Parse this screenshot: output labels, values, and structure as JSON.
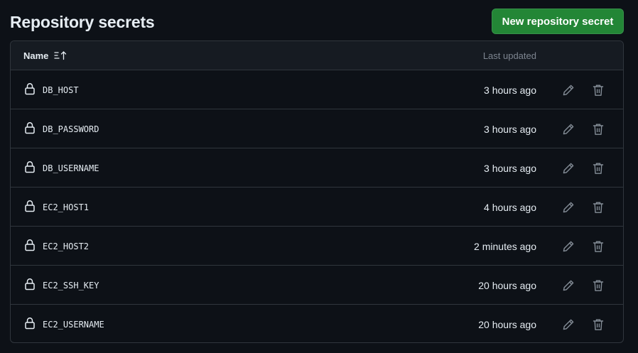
{
  "page": {
    "title": "Repository secrets",
    "new_secret_label": "New repository secret"
  },
  "table": {
    "name_header": "Name",
    "updated_header": "Last updated",
    "sort_icon": "sort-ascending-icon",
    "rows": [
      {
        "name": "DB_HOST",
        "updated": "3 hours ago"
      },
      {
        "name": "DB_PASSWORD",
        "updated": "3 hours ago"
      },
      {
        "name": "DB_USERNAME",
        "updated": "3 hours ago"
      },
      {
        "name": "EC2_HOST1",
        "updated": "4 hours ago"
      },
      {
        "name": "EC2_HOST2",
        "updated": "2 minutes ago"
      },
      {
        "name": "EC2_SSH_KEY",
        "updated": "20 hours ago"
      },
      {
        "name": "EC2_USERNAME",
        "updated": "20 hours ago"
      }
    ],
    "row_icons": {
      "lock": "lock-icon",
      "edit": "pencil-icon",
      "delete": "trash-icon"
    }
  },
  "colors": {
    "background": "#0d1117",
    "header_background": "#161b22",
    "border": "#30363d",
    "primary_button": "#238636",
    "text": "#e6edf3",
    "muted_text": "#7d8590",
    "icon": "#848d97"
  }
}
